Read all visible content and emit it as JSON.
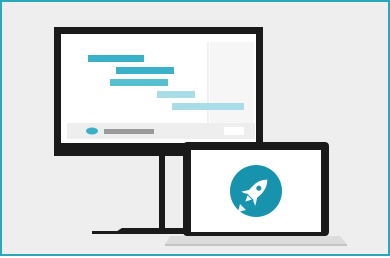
{
  "illustration": {
    "monitor_icon": "gantt-timeline-icon",
    "laptop_icon": "rocket-icon"
  },
  "colors": {
    "border": "#2aa7bd",
    "background": "#eeeeee",
    "device_frame": "#1a1a1a",
    "screen": "#ffffff",
    "panel": "#f1f1f1",
    "bar_dark": "#3ab1c8",
    "bar_mid": "#56bfd2",
    "bar_light": "#a8dde8",
    "accent_teal": "#1793ad",
    "grey_bar": "#9a9a9a"
  }
}
